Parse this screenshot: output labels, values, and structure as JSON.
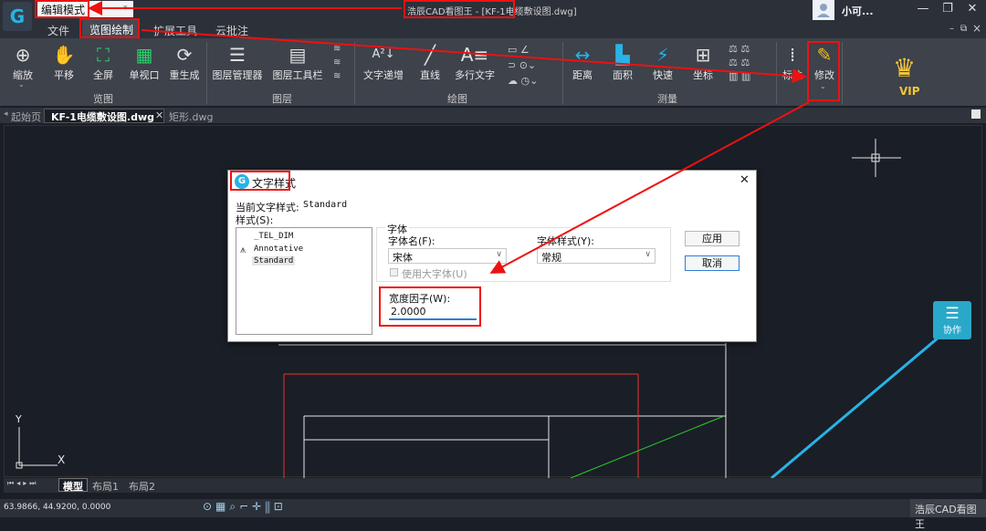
{
  "titlebar": {
    "mode_value": "编辑模式",
    "title": "浩辰CAD看图王 - [KF-1电缆敷设图.dwg]",
    "username": "小可..."
  },
  "window_controls": {
    "minimize": "—",
    "restore": "❐",
    "close": "✕",
    "mdi_minimize": "–",
    "mdi_restore": "⧉",
    "mdi_close": "×"
  },
  "menu": {
    "file": "文件",
    "view_draw": "览图绘制",
    "extend": "扩展工具",
    "cloud": "云批注"
  },
  "ribbon": {
    "view": {
      "zoom": "缩放",
      "pan": "平移",
      "fullscreen": "全屏",
      "single_view": "单视口",
      "regen": "重生成",
      "group": "览图"
    },
    "layer": {
      "manager": "图层管理器",
      "toolbar": "图层工具栏",
      "group": "图层"
    },
    "draw": {
      "text_increment": "文字递增",
      "line": "直线",
      "mtext": "多行文字",
      "group": "绘图"
    },
    "measure": {
      "distance": "距离",
      "area": "面积",
      "quick": "快速",
      "coord": "坐标",
      "group": "测量"
    },
    "annotate": "标注",
    "modify": "修改",
    "vip": "VIP"
  },
  "doctabs": {
    "start": "起始页",
    "active": "KF-1电缆敷设图.dwg",
    "other": "矩形.dwg"
  },
  "dialog": {
    "title": "文字样式",
    "current_label": "当前文字样式:",
    "current_value": "Standard",
    "styles_label": "样式(S):",
    "styles": [
      "_TEL_DIM",
      "Annotative",
      "Standard"
    ],
    "font_group": "字体",
    "font_name_label": "字体名(F):",
    "font_name_value": "宋体",
    "font_style_label": "字体样式(Y):",
    "font_style_value": "常规",
    "big_font_label": "使用大字体(U)",
    "width_label": "宽度因子(W):",
    "width_value": "2.0000",
    "apply": "应用",
    "cancel": "取消"
  },
  "collab": "协作",
  "axes": {
    "y": "Y",
    "x": "X"
  },
  "layout_tabs": {
    "model": "模型",
    "layout1": "布局1",
    "layout2": "布局2"
  },
  "status": {
    "coords": "63.9866, 44.9200, 0.0000",
    "brand": "浩辰CAD看图王"
  },
  "colors": {
    "highlight": "#e11111",
    "accent_cyan": "#27b3e6",
    "ribbon_bg": "#3d424b",
    "canvas_bg": "#1a1e26"
  }
}
